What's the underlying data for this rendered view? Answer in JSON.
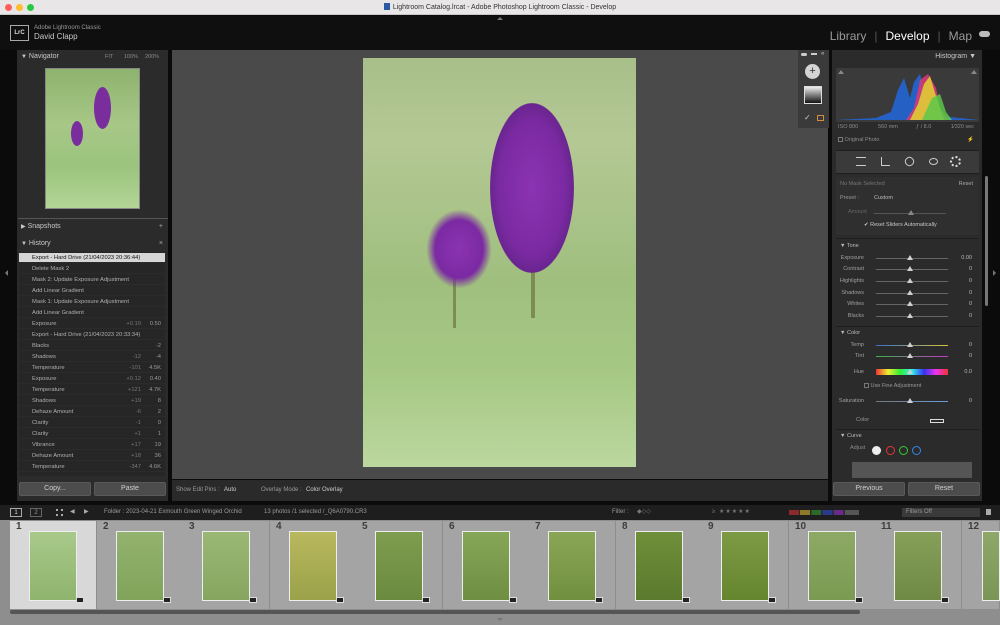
{
  "window": {
    "title": "Lightroom Catalog.lrcat - Adobe Photoshop Lightroom Classic - Develop"
  },
  "identity": {
    "app": "Adobe Lightroom Classic",
    "user": "David Clapp",
    "logo": "LrC"
  },
  "modules": [
    "Library",
    "Develop",
    "Map"
  ],
  "colors": {
    "accent": "#ffffff",
    "panel": "#2e2e2e",
    "active_row": "#d8d8d8"
  },
  "navigator": {
    "label": "Navigator",
    "zoom": [
      "FIT",
      "100%",
      "200%"
    ]
  },
  "snapshots": {
    "label": "Snapshots"
  },
  "history": {
    "label": "History",
    "items": [
      {
        "name": "Export - Hard Drive (21/04/2023 20:36:44)",
        "a": "",
        "b": ""
      },
      {
        "name": "Delete Mask 2",
        "a": "",
        "b": ""
      },
      {
        "name": "Mask 2: Update Exposure Adjustment",
        "a": "",
        "b": ""
      },
      {
        "name": "Add Linear Gradient",
        "a": "",
        "b": ""
      },
      {
        "name": "Mask 1: Update Exposure Adjustment",
        "a": "",
        "b": ""
      },
      {
        "name": "Add Linear Gradient",
        "a": "",
        "b": ""
      },
      {
        "name": "Exposure",
        "a": "+0.10",
        "b": "0.50"
      },
      {
        "name": "Export - Hard Drive (21/04/2023 20:33:34)",
        "a": "",
        "b": ""
      },
      {
        "name": "Blacks",
        "a": "",
        "b": "-2"
      },
      {
        "name": "Shadows",
        "a": "-12",
        "b": "-4"
      },
      {
        "name": "Temperature",
        "a": "-101",
        "b": "4.5K"
      },
      {
        "name": "Exposure",
        "a": "+0.12",
        "b": "0.40"
      },
      {
        "name": "Temperature",
        "a": "+121",
        "b": "4.7K"
      },
      {
        "name": "Shadows",
        "a": "+19",
        "b": "8"
      },
      {
        "name": "Dehaze Amount",
        "a": "-6",
        "b": "2"
      },
      {
        "name": "Clarity",
        "a": "-1",
        "b": "0"
      },
      {
        "name": "Clarity",
        "a": "+1",
        "b": "1"
      },
      {
        "name": "Vibrance",
        "a": "+17",
        "b": "19"
      },
      {
        "name": "Dehaze Amount",
        "a": "+18",
        "b": "36"
      },
      {
        "name": "Temperature",
        "a": "-347",
        "b": "4.6K"
      }
    ]
  },
  "left_buttons": {
    "copy": "Copy...",
    "paste": "Paste"
  },
  "toolbar": {
    "edit_pins_label": "Show Edit Pins :",
    "edit_pins_value": "Auto",
    "overlay_label": "Overlay Mode :",
    "overlay_value": "Color Overlay"
  },
  "histogram": {
    "label": "Histogram",
    "iso": "ISO 800",
    "focal": "560 mm",
    "aperture": "ƒ / 8.0",
    "shutter": "1⁄320 sec",
    "original": "Original Photo"
  },
  "masking": {
    "no_mask": "No Mask Selected",
    "reset": "Reset",
    "preset_label": "Preset :",
    "preset_value": "Custom",
    "amount": "Amount",
    "auto_reset": "Reset Sliders Automatically"
  },
  "tone": {
    "label": "Tone",
    "sliders": [
      {
        "name": "Exposure",
        "value": "0.00"
      },
      {
        "name": "Contrast",
        "value": "0"
      },
      {
        "name": "Highlights",
        "value": "0"
      },
      {
        "name": "Shadows",
        "value": "0"
      },
      {
        "name": "Whites",
        "value": "0"
      },
      {
        "name": "Blacks",
        "value": "0"
      }
    ]
  },
  "color": {
    "label": "Color",
    "temp": "Temp",
    "temp_value": "0",
    "tint": "Tint",
    "tint_value": "0",
    "hue": "Hue",
    "hue_value": "0.0",
    "fine": "Use Fine Adjustment",
    "saturation": "Saturation",
    "sat_value": "0",
    "color_label": "Color"
  },
  "curve": {
    "label": "Curve",
    "adjust": "Adjust"
  },
  "right_buttons": {
    "previous": "Previous",
    "reset": "Reset"
  },
  "filmstrip_bar": {
    "page1": "1",
    "page2": "2",
    "folder": "Folder : 2023-04-21 Exmouth Green Winged Orchid",
    "count": "13 photos /1 selected /_Q6A0790.CR3",
    "filter_label": "Filter :",
    "filter_value": "Filters Off"
  },
  "filmstrip": [
    "1",
    "2",
    "3",
    "4",
    "5",
    "6",
    "7",
    "8",
    "9",
    "10",
    "11",
    "12"
  ]
}
